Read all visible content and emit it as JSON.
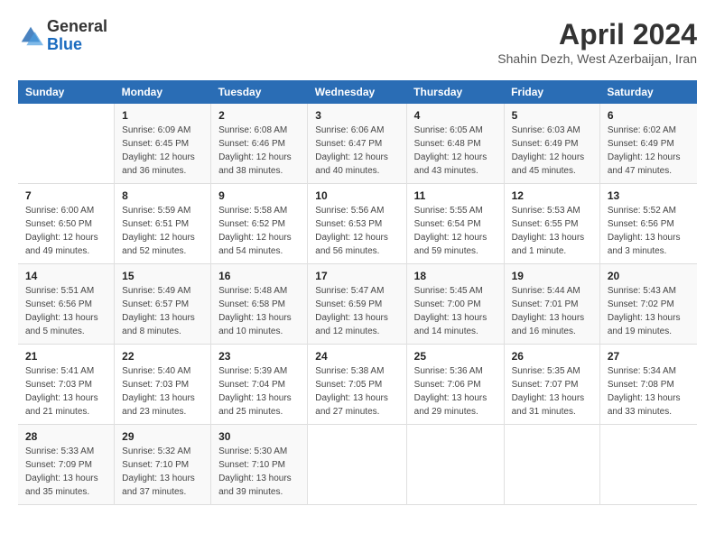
{
  "logo": {
    "general": "General",
    "blue": "Blue"
  },
  "header": {
    "title": "April 2024",
    "location": "Shahin Dezh, West Azerbaijan, Iran"
  },
  "weekdays": [
    "Sunday",
    "Monday",
    "Tuesday",
    "Wednesday",
    "Thursday",
    "Friday",
    "Saturday"
  ],
  "weeks": [
    [
      {
        "day": "",
        "info": ""
      },
      {
        "day": "1",
        "info": "Sunrise: 6:09 AM\nSunset: 6:45 PM\nDaylight: 12 hours\nand 36 minutes."
      },
      {
        "day": "2",
        "info": "Sunrise: 6:08 AM\nSunset: 6:46 PM\nDaylight: 12 hours\nand 38 minutes."
      },
      {
        "day": "3",
        "info": "Sunrise: 6:06 AM\nSunset: 6:47 PM\nDaylight: 12 hours\nand 40 minutes."
      },
      {
        "day": "4",
        "info": "Sunrise: 6:05 AM\nSunset: 6:48 PM\nDaylight: 12 hours\nand 43 minutes."
      },
      {
        "day": "5",
        "info": "Sunrise: 6:03 AM\nSunset: 6:49 PM\nDaylight: 12 hours\nand 45 minutes."
      },
      {
        "day": "6",
        "info": "Sunrise: 6:02 AM\nSunset: 6:49 PM\nDaylight: 12 hours\nand 47 minutes."
      }
    ],
    [
      {
        "day": "7",
        "info": "Sunrise: 6:00 AM\nSunset: 6:50 PM\nDaylight: 12 hours\nand 49 minutes."
      },
      {
        "day": "8",
        "info": "Sunrise: 5:59 AM\nSunset: 6:51 PM\nDaylight: 12 hours\nand 52 minutes."
      },
      {
        "day": "9",
        "info": "Sunrise: 5:58 AM\nSunset: 6:52 PM\nDaylight: 12 hours\nand 54 minutes."
      },
      {
        "day": "10",
        "info": "Sunrise: 5:56 AM\nSunset: 6:53 PM\nDaylight: 12 hours\nand 56 minutes."
      },
      {
        "day": "11",
        "info": "Sunrise: 5:55 AM\nSunset: 6:54 PM\nDaylight: 12 hours\nand 59 minutes."
      },
      {
        "day": "12",
        "info": "Sunrise: 5:53 AM\nSunset: 6:55 PM\nDaylight: 13 hours\nand 1 minute."
      },
      {
        "day": "13",
        "info": "Sunrise: 5:52 AM\nSunset: 6:56 PM\nDaylight: 13 hours\nand 3 minutes."
      }
    ],
    [
      {
        "day": "14",
        "info": "Sunrise: 5:51 AM\nSunset: 6:56 PM\nDaylight: 13 hours\nand 5 minutes."
      },
      {
        "day": "15",
        "info": "Sunrise: 5:49 AM\nSunset: 6:57 PM\nDaylight: 13 hours\nand 8 minutes."
      },
      {
        "day": "16",
        "info": "Sunrise: 5:48 AM\nSunset: 6:58 PM\nDaylight: 13 hours\nand 10 minutes."
      },
      {
        "day": "17",
        "info": "Sunrise: 5:47 AM\nSunset: 6:59 PM\nDaylight: 13 hours\nand 12 minutes."
      },
      {
        "day": "18",
        "info": "Sunrise: 5:45 AM\nSunset: 7:00 PM\nDaylight: 13 hours\nand 14 minutes."
      },
      {
        "day": "19",
        "info": "Sunrise: 5:44 AM\nSunset: 7:01 PM\nDaylight: 13 hours\nand 16 minutes."
      },
      {
        "day": "20",
        "info": "Sunrise: 5:43 AM\nSunset: 7:02 PM\nDaylight: 13 hours\nand 19 minutes."
      }
    ],
    [
      {
        "day": "21",
        "info": "Sunrise: 5:41 AM\nSunset: 7:03 PM\nDaylight: 13 hours\nand 21 minutes."
      },
      {
        "day": "22",
        "info": "Sunrise: 5:40 AM\nSunset: 7:03 PM\nDaylight: 13 hours\nand 23 minutes."
      },
      {
        "day": "23",
        "info": "Sunrise: 5:39 AM\nSunset: 7:04 PM\nDaylight: 13 hours\nand 25 minutes."
      },
      {
        "day": "24",
        "info": "Sunrise: 5:38 AM\nSunset: 7:05 PM\nDaylight: 13 hours\nand 27 minutes."
      },
      {
        "day": "25",
        "info": "Sunrise: 5:36 AM\nSunset: 7:06 PM\nDaylight: 13 hours\nand 29 minutes."
      },
      {
        "day": "26",
        "info": "Sunrise: 5:35 AM\nSunset: 7:07 PM\nDaylight: 13 hours\nand 31 minutes."
      },
      {
        "day": "27",
        "info": "Sunrise: 5:34 AM\nSunset: 7:08 PM\nDaylight: 13 hours\nand 33 minutes."
      }
    ],
    [
      {
        "day": "28",
        "info": "Sunrise: 5:33 AM\nSunset: 7:09 PM\nDaylight: 13 hours\nand 35 minutes."
      },
      {
        "day": "29",
        "info": "Sunrise: 5:32 AM\nSunset: 7:10 PM\nDaylight: 13 hours\nand 37 minutes."
      },
      {
        "day": "30",
        "info": "Sunrise: 5:30 AM\nSunset: 7:10 PM\nDaylight: 13 hours\nand 39 minutes."
      },
      {
        "day": "",
        "info": ""
      },
      {
        "day": "",
        "info": ""
      },
      {
        "day": "",
        "info": ""
      },
      {
        "day": "",
        "info": ""
      }
    ]
  ]
}
